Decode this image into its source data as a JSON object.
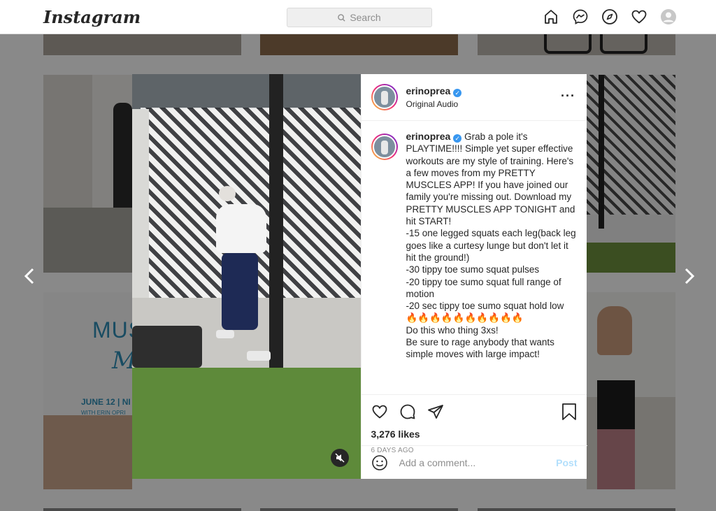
{
  "app": {
    "logo": "Instagram"
  },
  "search": {
    "label": "Search"
  },
  "nav": {
    "icons": [
      "home-icon",
      "messenger-icon",
      "explore-icon",
      "activity-heart-icon",
      "profile-avatar"
    ]
  },
  "tile_promo": {
    "line1": "MUS",
    "line2": "Min",
    "date": "JUNE 12 | NI",
    "host": "WITH ERIN OPRI"
  },
  "post": {
    "username": "erinoprea",
    "audio": "Original Audio",
    "caption": "Grab a pole it's PLAYTIME!!!! Simple yet super effective workouts are my style of training. Here's a few moves from my PRETTY MUSCLES APP! If you have joined our family you're missing out. Download my PRETTY MUSCLES APP TONIGHT and hit START!\n-15 one legged squats each leg(back leg goes like a curtesy lunge but don't let it hit the ground!)\n-30 tippy toe sumo squat pulses\n-20 tippy toe sumo squat full range of motion\n-20 sec tippy toe sumo squat hold low\n🔥🔥🔥🔥🔥🔥🔥🔥🔥🔥\nDo this who thing 3xs!\nBe sure to rage anybody that wants simple moves with large impact!",
    "likes": "3,276 likes",
    "time_ago": "6 DAYS AGO",
    "comment_placeholder": "Add a comment...",
    "post_button": "Post"
  },
  "colors": {
    "accent": "#3897f0",
    "post_disabled": "#b2dffc"
  }
}
